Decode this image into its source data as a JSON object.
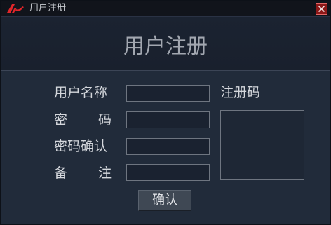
{
  "window": {
    "title": "用户注册",
    "accent_color": "#e0262a",
    "close_icon": "close-icon"
  },
  "header": {
    "title": "用户注册"
  },
  "form": {
    "username_label": "用户名称",
    "password_label_chars": [
      "密",
      "码"
    ],
    "confirm_password_label": "密码确认",
    "remark_label_chars": [
      "备",
      "注"
    ],
    "registration_code_label": "注册码",
    "username_value": "",
    "password_value": "",
    "confirm_password_value": "",
    "remark_value": "",
    "registration_code_value": ""
  },
  "actions": {
    "confirm_label": "确认"
  }
}
